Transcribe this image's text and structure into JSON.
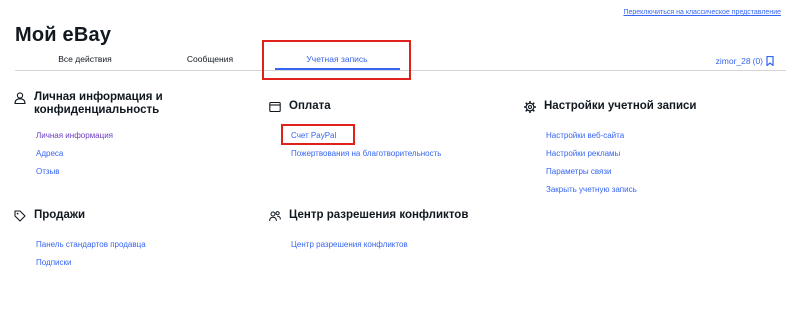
{
  "header": {
    "classic_link": "Переключиться на классическое представление",
    "title": "Мой eBay"
  },
  "tabs": {
    "all_actions": "Все действия",
    "messages": "Сообщения",
    "account": "Учетная запись"
  },
  "user": {
    "name": "zimor_28",
    "count": "(0)"
  },
  "sections": {
    "personal": {
      "icon": "person-icon",
      "title_line1": "Личная информация и",
      "title_line2": "конфиденциальность",
      "links": [
        "Личная информация",
        "Адреса",
        "Отзыв"
      ]
    },
    "payment": {
      "icon": "card-icon",
      "title": "Оплата",
      "links": [
        "Счет PayPal",
        "Пожертвования на благотворительность"
      ]
    },
    "settings": {
      "icon": "gear-icon",
      "title": "Настройки учетной записи",
      "links": [
        "Настройки веб-сайта",
        "Настройки рекламы",
        "Параметры связи",
        "Закрыть учетную запись"
      ]
    },
    "selling": {
      "icon": "tag-icon",
      "title": "Продажи",
      "links": [
        "Панель стандартов продавца",
        "Подписки"
      ]
    },
    "resolution": {
      "icon": "people-icon",
      "title": "Центр разрешения конфликтов",
      "links": [
        "Центр разрешения конфликтов"
      ]
    }
  },
  "colors": {
    "link": "#3665f3",
    "visited": "#6e3ec4",
    "highlight": "#e0201b",
    "text": "#111820"
  }
}
